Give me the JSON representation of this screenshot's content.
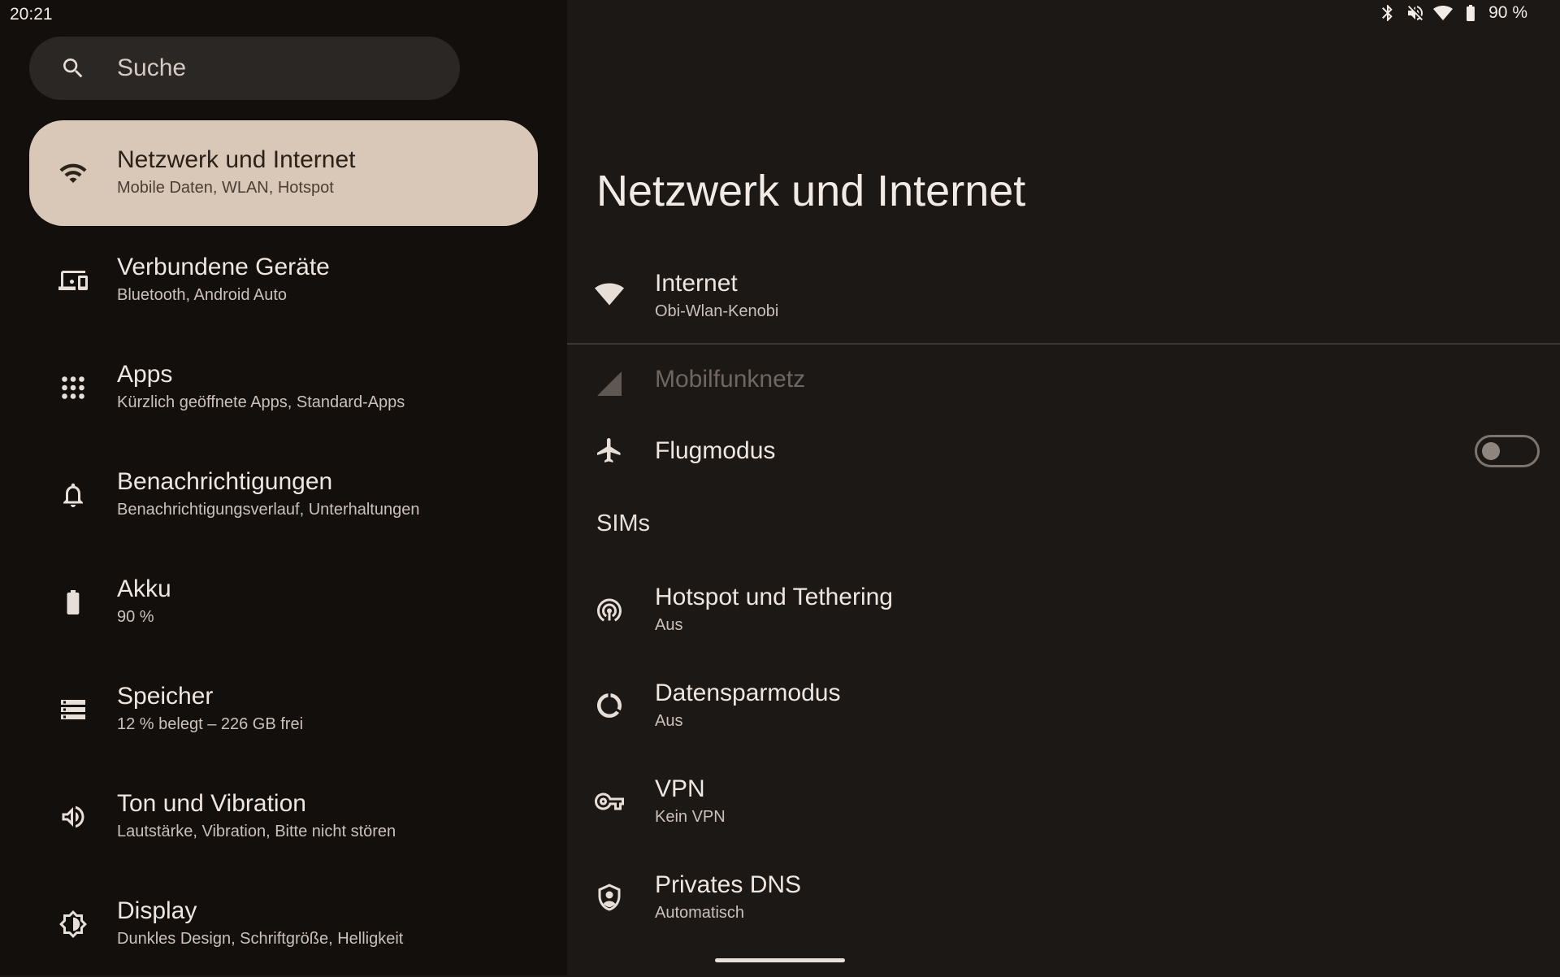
{
  "status_bar": {
    "time": "20:21",
    "battery": "90 %"
  },
  "search": {
    "placeholder": "Suche",
    "icon": "search-icon"
  },
  "nav": [
    {
      "title": "Netzwerk und Internet",
      "sub": "Mobile Daten, WLAN, Hotspot",
      "icon": "wifi-icon",
      "active": true
    },
    {
      "title": "Verbundene Geräte",
      "sub": "Bluetooth, Android Auto",
      "icon": "devices-icon"
    },
    {
      "title": "Apps",
      "sub": "Kürzlich geöffnete Apps, Standard-Apps",
      "icon": "apps-grid-icon"
    },
    {
      "title": "Benachrichtigungen",
      "sub": "Benachrichtigungsverlauf, Unterhaltungen",
      "icon": "bell-icon"
    },
    {
      "title": "Akku",
      "sub": "90 %",
      "icon": "battery-icon"
    },
    {
      "title": "Speicher",
      "sub": "12 % belegt – 226 GB frei",
      "icon": "storage-icon"
    },
    {
      "title": "Ton und Vibration",
      "sub": "Lautstärke, Vibration, Bitte nicht stören",
      "icon": "speaker-icon"
    },
    {
      "title": "Display",
      "sub": "Dunkles Design, Schriftgröße, Helligkeit",
      "icon": "brightness-icon"
    }
  ],
  "main": {
    "title": "Netzwerk und Internet",
    "internet": {
      "title": "Internet",
      "sub": "Obi-Wlan-Kenobi",
      "icon": "wifi-filled-icon"
    },
    "mobile": {
      "title": "Mobilfunknetz",
      "icon": "cell-signal-icon",
      "enabled": false
    },
    "airplane": {
      "title": "Flugmodus",
      "icon": "airplane-icon",
      "toggle_on": false
    },
    "section_sims": "SIMs",
    "hotspot": {
      "title": "Hotspot und Tethering",
      "sub": "Aus",
      "icon": "hotspot-icon"
    },
    "datasaver": {
      "title": "Datensparmodus",
      "sub": "Aus",
      "icon": "data-saver-icon"
    },
    "vpn": {
      "title": "VPN",
      "sub": "Kein VPN",
      "icon": "vpn-key-icon"
    },
    "dns": {
      "title": "Privates DNS",
      "sub": "Automatisch",
      "icon": "shield-icon"
    }
  }
}
